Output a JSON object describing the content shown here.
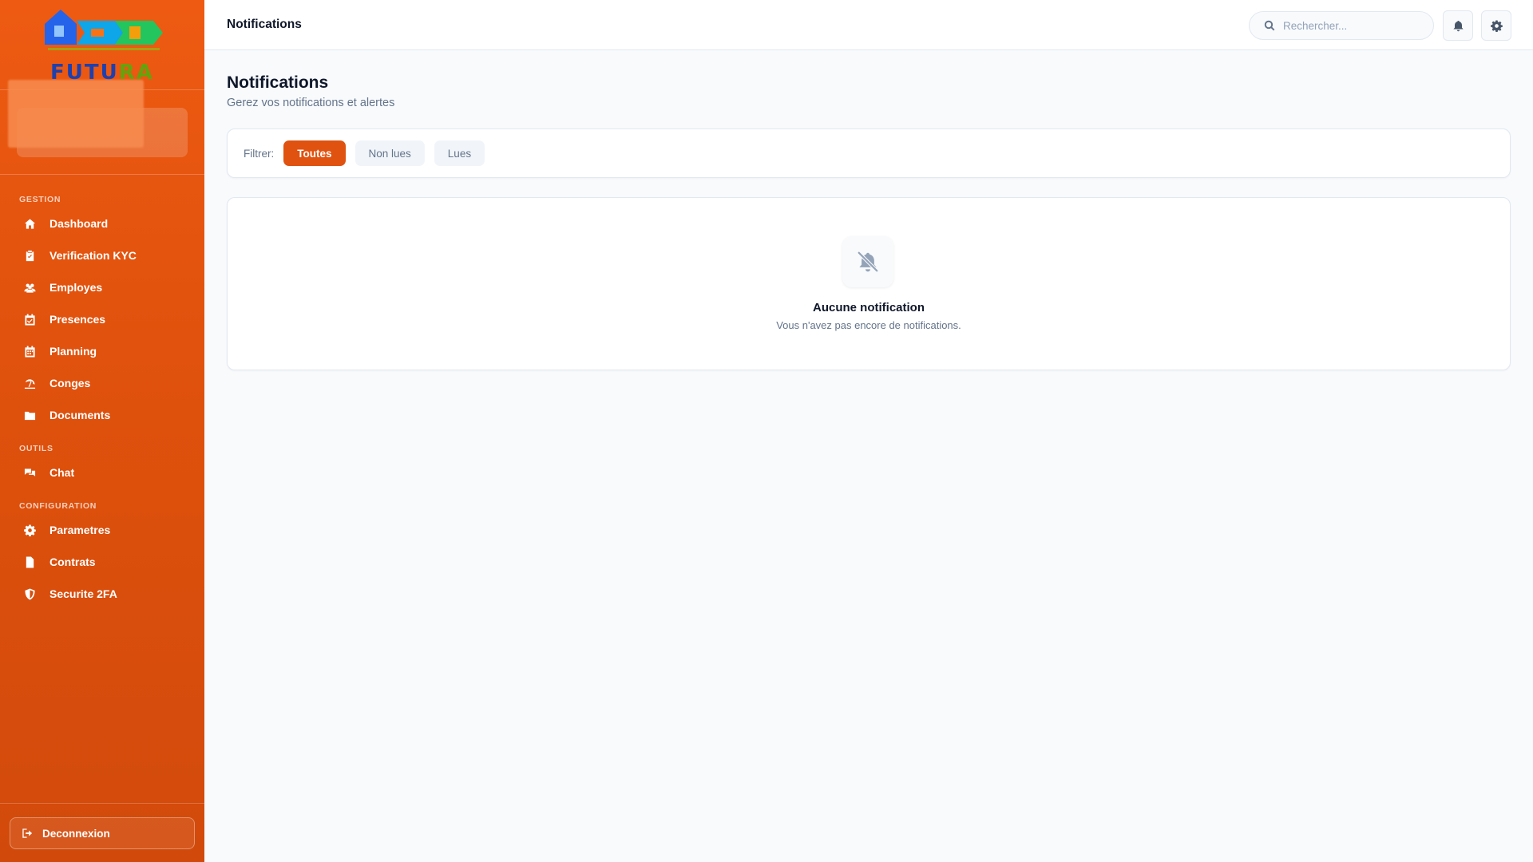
{
  "brand": {
    "logo_text_a": "FUTU",
    "logo_text_b": "RA"
  },
  "sidebar": {
    "sections": [
      {
        "label": "GESTION",
        "items": [
          {
            "label": "Dashboard",
            "icon": "home-icon"
          },
          {
            "label": "Verification KYC",
            "icon": "clipboard-check-icon"
          },
          {
            "label": "Employes",
            "icon": "users-icon"
          },
          {
            "label": "Presences",
            "icon": "calendar-check-icon"
          },
          {
            "label": "Planning",
            "icon": "calendar-icon"
          },
          {
            "label": "Conges",
            "icon": "umbrella-beach-icon"
          },
          {
            "label": "Documents",
            "icon": "folder-icon"
          }
        ]
      },
      {
        "label": "OUTILS",
        "items": [
          {
            "label": "Chat",
            "icon": "chat-icon"
          }
        ]
      },
      {
        "label": "CONFIGURATION",
        "items": [
          {
            "label": "Parametres",
            "icon": "gear-icon"
          },
          {
            "label": "Contrats",
            "icon": "file-contract-icon"
          },
          {
            "label": "Securite 2FA",
            "icon": "shield-icon"
          }
        ]
      }
    ],
    "logout_label": "Deconnexion"
  },
  "header": {
    "title": "Notifications",
    "search_placeholder": "Rechercher..."
  },
  "main": {
    "title": "Notifications",
    "subtitle": "Gerez vos notifications et alertes",
    "filter": {
      "label": "Filtrer:",
      "options": [
        "Toutes",
        "Non lues",
        "Lues"
      ],
      "selected": "Toutes"
    },
    "empty": {
      "title": "Aucune notification",
      "text": "Vous n'avez pas encore de notifications."
    }
  },
  "colors": {
    "sidebar": "#e8560f",
    "accent": "#e05210",
    "background": "#f8fafc"
  }
}
